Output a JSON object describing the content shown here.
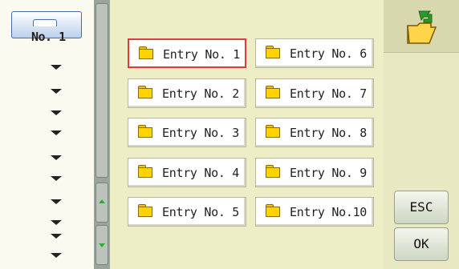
{
  "folder_tab": {
    "label": "No. 1",
    "icon": "folder-icon"
  },
  "left_list": {
    "marker_count": 10,
    "marker_icon": "down-arrow-icon"
  },
  "entries": [
    {
      "label": "Entry No. 1",
      "selected": true
    },
    {
      "label": "Entry No. 2",
      "selected": false
    },
    {
      "label": "Entry No. 3",
      "selected": false
    },
    {
      "label": "Entry No. 4",
      "selected": false
    },
    {
      "label": "Entry No. 5",
      "selected": false
    },
    {
      "label": "Entry No. 6",
      "selected": false
    },
    {
      "label": "Entry No. 7",
      "selected": false
    },
    {
      "label": "Entry No. 8",
      "selected": false
    },
    {
      "label": "Entry No. 9",
      "selected": false
    },
    {
      "label": "Entry No.10",
      "selected": false
    }
  ],
  "right_panel": {
    "icon": "open-folder-up-icon",
    "esc_label": "ESC",
    "ok_label": "OK"
  },
  "colors": {
    "selected_border": "#e03a3a",
    "folder_yellow": "#ffd300",
    "scroll_arrow": "#2ab02a"
  }
}
